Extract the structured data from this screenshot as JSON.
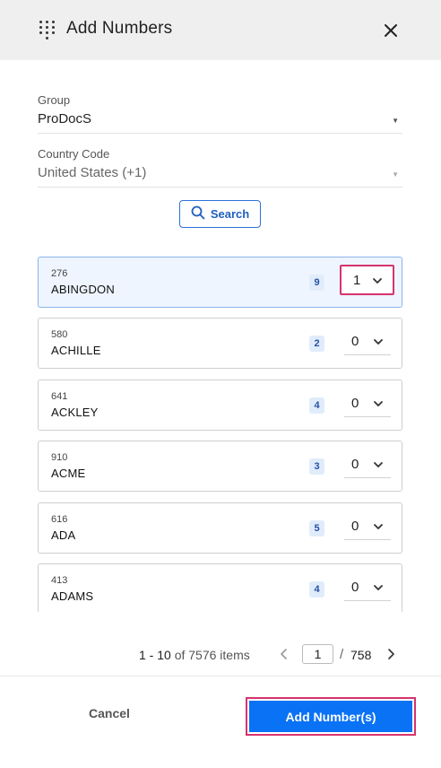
{
  "dialog": {
    "title": "Add Numbers",
    "close_icon": "close-icon",
    "header_icon": "dialpad-icon"
  },
  "form": {
    "group": {
      "label": "Group",
      "value": "ProDocS"
    },
    "country": {
      "label": "Country Code",
      "value": "United States (+1)"
    },
    "search_label": "Search"
  },
  "results": [
    {
      "code": "276",
      "city": "ABINGDON",
      "available": "9",
      "qty": "1",
      "selected": true
    },
    {
      "code": "580",
      "city": "ACHILLE",
      "available": "2",
      "qty": "0",
      "selected": false
    },
    {
      "code": "641",
      "city": "ACKLEY",
      "available": "4",
      "qty": "0",
      "selected": false
    },
    {
      "code": "910",
      "city": "ACME",
      "available": "3",
      "qty": "0",
      "selected": false
    },
    {
      "code": "616",
      "city": "ADA",
      "available": "5",
      "qty": "0",
      "selected": false
    },
    {
      "code": "413",
      "city": "ADAMS",
      "available": "4",
      "qty": "0",
      "selected": false
    }
  ],
  "pagination": {
    "range_prefix": "1 - 10",
    "range_suffix": "of 7576 items",
    "current_page": "1",
    "slash": "/",
    "total_pages": "758"
  },
  "footer": {
    "cancel_label": "Cancel",
    "add_label": "Add Number(s)"
  },
  "colors": {
    "primary": "#0a72f5",
    "highlight": "#d6336c",
    "selected_row": "#eef5ff",
    "header_bg": "#efefef"
  }
}
